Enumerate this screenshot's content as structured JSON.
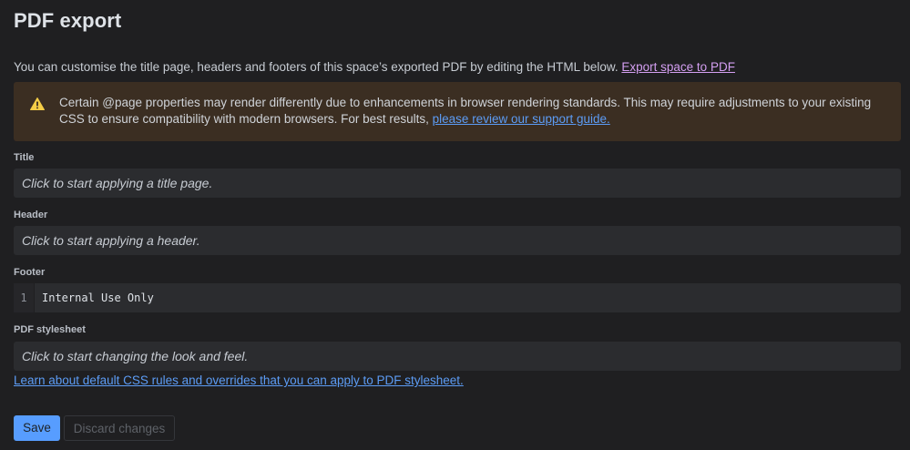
{
  "page": {
    "title": "PDF export",
    "intro_text": "You can customise the title page, headers and footers of this space’s exported PDF by editing the HTML below. ",
    "intro_link": "Export space to PDF"
  },
  "warning": {
    "icon": "warning-triangle-icon",
    "text": "Certain @page properties may render differently due to enhancements in browser rendering standards. This may require adjustments to your existing CSS to ensure compatibility with modern browsers. For best results, ",
    "link": "please review our support guide.",
    "color": "#3b2e22",
    "icon_color": "#f5cd47"
  },
  "fields": {
    "title": {
      "label": "Title",
      "placeholder": "Click to start applying a title page."
    },
    "header": {
      "label": "Header",
      "placeholder": "Click to start applying a header."
    },
    "footer": {
      "label": "Footer",
      "line_number": "1",
      "code": "Internal Use Only"
    },
    "stylesheet": {
      "label": "PDF stylesheet",
      "placeholder": "Click to start changing the look and feel."
    }
  },
  "learn_link": "Learn about default CSS rules and overrides that you can apply to PDF stylesheet.",
  "actions": {
    "save_label": "Save",
    "discard_label": "Discard changes",
    "accent": "#579dff"
  }
}
